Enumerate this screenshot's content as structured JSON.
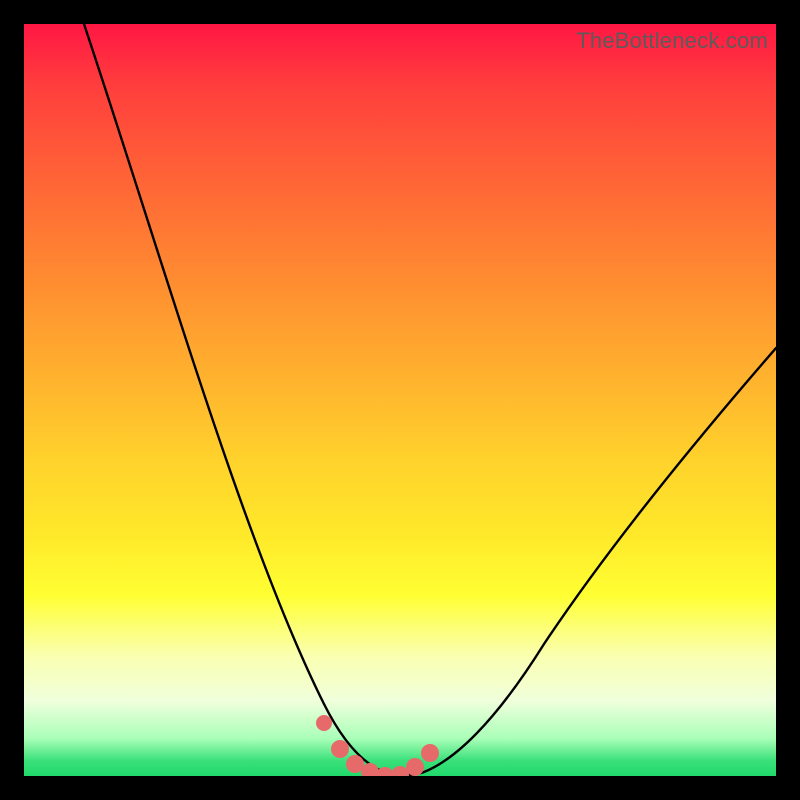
{
  "watermark": "TheBottleneck.com",
  "colors": {
    "frame_bg": "#000000",
    "curve_stroke": "#000000",
    "dot_fill": "#e76a6a",
    "gradient_stops": [
      "#ff1744",
      "#ff3d3d",
      "#ff5c38",
      "#ff7a33",
      "#ff9830",
      "#ffb52e",
      "#ffd22c",
      "#ffe92a",
      "#ffff33",
      "#faffb0",
      "#f0ffdc",
      "#aaffb8",
      "#39e079",
      "#20d86b"
    ]
  },
  "chart_data": {
    "type": "line",
    "title": "",
    "xlabel": "",
    "ylabel": "",
    "xlim": [
      0,
      100
    ],
    "ylim": [
      0,
      100
    ],
    "grid": false,
    "legend": false,
    "series": [
      {
        "name": "bottleneck_curve",
        "x": [
          8,
          12,
          16,
          20,
          24,
          28,
          32,
          35,
          38,
          40,
          42,
          44,
          46,
          48,
          50,
          53,
          57,
          62,
          68,
          75,
          83,
          92,
          100
        ],
        "values": [
          100,
          88,
          76,
          64,
          53,
          42,
          32,
          24,
          16,
          10,
          6,
          3,
          1,
          0,
          0,
          1,
          4,
          9,
          16,
          25,
          35,
          46,
          57
        ]
      },
      {
        "name": "bottom_marker_dots",
        "x": [
          40,
          42,
          44,
          46,
          48,
          50,
          52,
          54
        ],
        "values": [
          7,
          3.5,
          1.5,
          0.5,
          0,
          0.2,
          1.2,
          3
        ]
      }
    ],
    "annotations": [
      {
        "text": "TheBottleneck.com",
        "position": "top-right"
      }
    ]
  }
}
